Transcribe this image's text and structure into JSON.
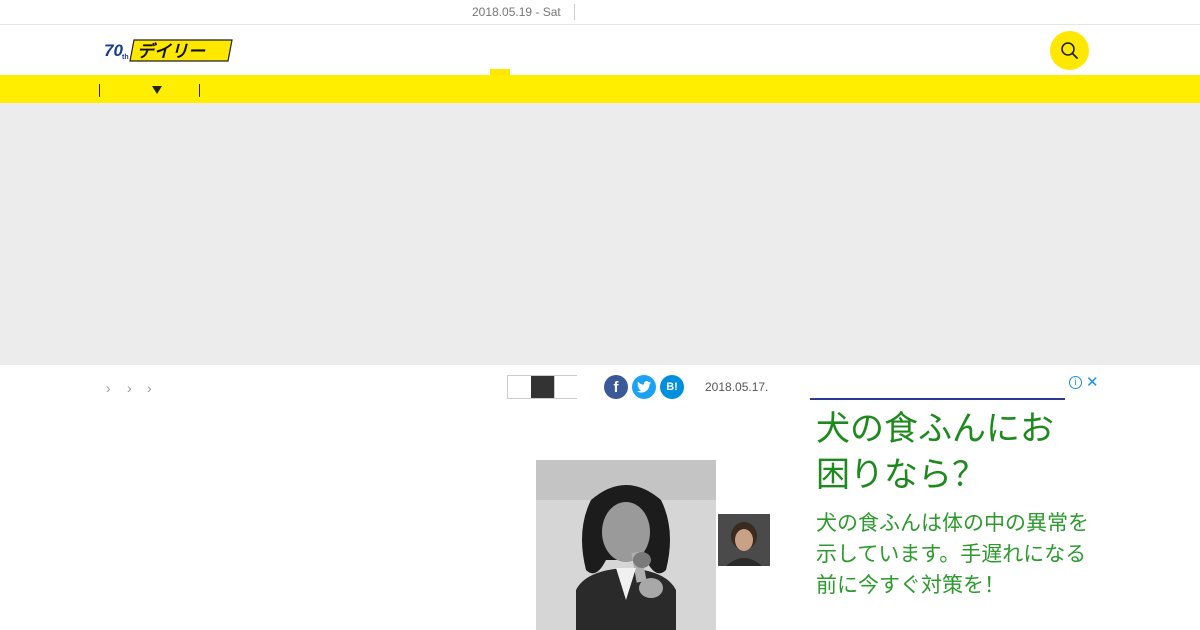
{
  "topbar": {
    "date": "2018.05.19 - Sat"
  },
  "header": {
    "logo_text": "デイリー",
    "logo_mark": "70th"
  },
  "article": {
    "date": "2018.05.17."
  },
  "share": {
    "facebook_label": "f",
    "hatena_label": "B!"
  },
  "breadcrumb": {
    "separators": [
      "›",
      "›",
      "›"
    ]
  },
  "ad": {
    "headline": "犬の食ふんにお困りなら？",
    "body": "犬の食ふんは体の中の異常を示しています。手遅れになる前に今すぐ対策を！",
    "info_label": "i",
    "close_label": "✕"
  },
  "colors": {
    "accent_yellow": "#ffee00",
    "ad_text_green": "#1d8a1d",
    "facebook": "#3b5998",
    "twitter": "#1da1f2",
    "hatena": "#008fde"
  },
  "icons": [
    "search-icon",
    "caret-down-icon",
    "facebook-icon",
    "twitter-icon",
    "hatena-bookmark-icon",
    "ad-info-icon",
    "ad-close-icon"
  ]
}
